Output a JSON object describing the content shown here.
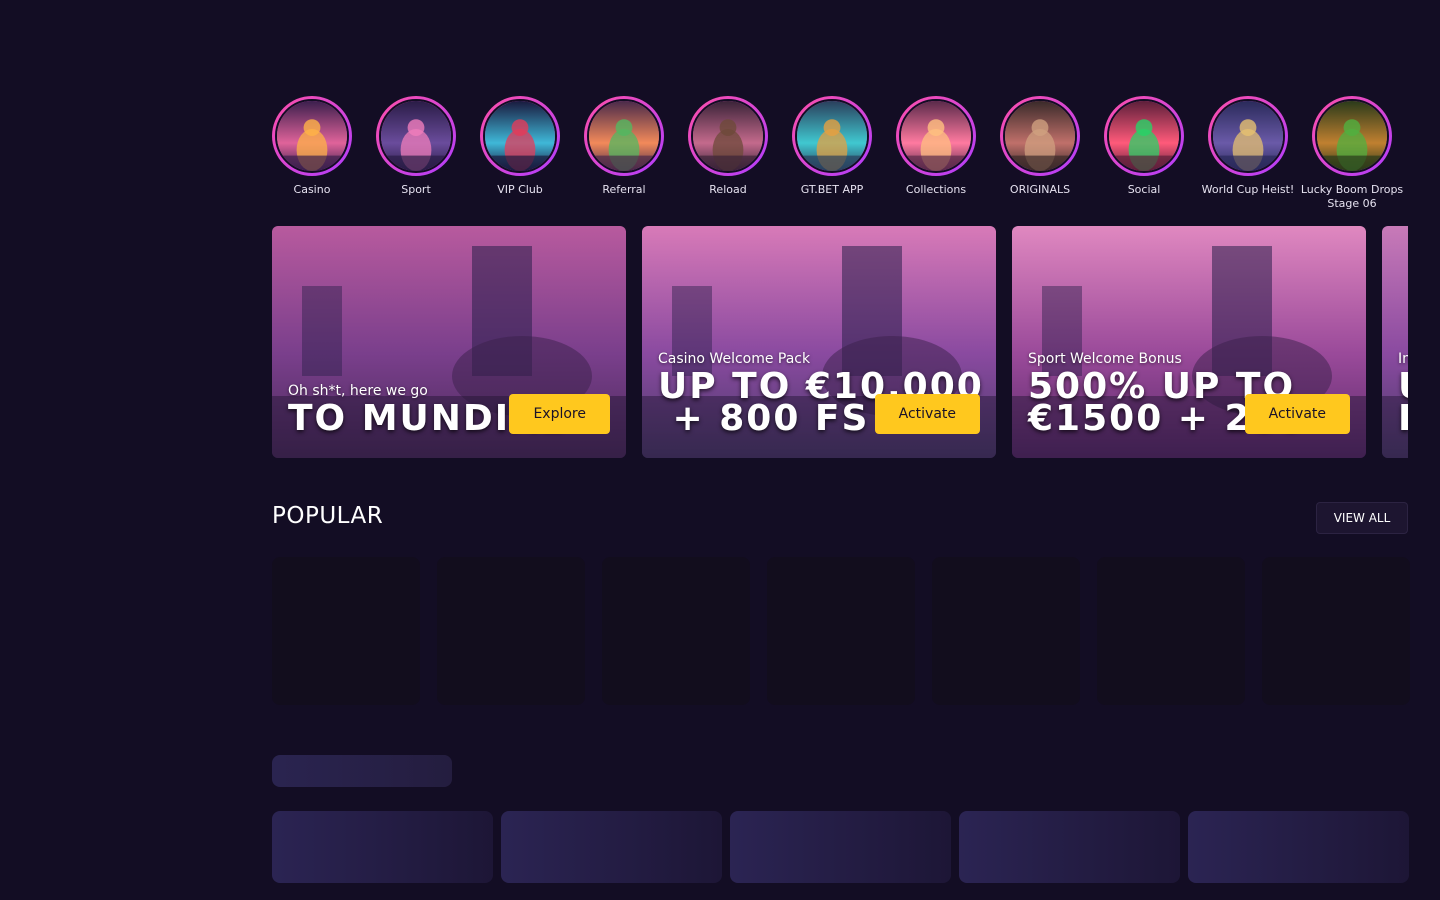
{
  "stories": [
    {
      "label": "Casino",
      "icon": "casino-story-icon",
      "colors": [
        "#3b1f4d",
        "#e0639a",
        "#ffb347"
      ]
    },
    {
      "label": "Sport",
      "icon": "sport-story-icon",
      "colors": [
        "#2a1c46",
        "#6a4c9c",
        "#f07dbb"
      ]
    },
    {
      "label": "VIP Club",
      "icon": "vip-club-story-icon",
      "colors": [
        "#1a1a3e",
        "#3fb8d8",
        "#e43b5a"
      ]
    },
    {
      "label": "Referral",
      "icon": "referral-story-icon",
      "colors": [
        "#4a2a4a",
        "#f28a5a",
        "#52b860"
      ]
    },
    {
      "label": "Reload",
      "icon": "reload-story-icon",
      "colors": [
        "#3a2338",
        "#c46a8c",
        "#6e4a3a"
      ]
    },
    {
      "label": "GT.BET APP",
      "icon": "gtbet-app-story-icon",
      "colors": [
        "#2a3f5c",
        "#40c8d0",
        "#e6a040"
      ]
    },
    {
      "label": "Collections",
      "icon": "collections-story-icon",
      "colors": [
        "#5a2a4a",
        "#ff7aa0",
        "#ffc080"
      ]
    },
    {
      "label": "ORIGINALS",
      "icon": "originals-story-icon",
      "colors": [
        "#3a2a2a",
        "#c0706a",
        "#d0a080"
      ]
    },
    {
      "label": "Social",
      "icon": "social-story-icon",
      "colors": [
        "#5c1f3a",
        "#ff5a7a",
        "#25d366"
      ]
    },
    {
      "label": "World Cup Heist!",
      "icon": "world-cup-story-icon",
      "colors": [
        "#2a2a5a",
        "#6a5aa8",
        "#e6c070"
      ]
    },
    {
      "label": "Lucky Boom Drops Stage 06",
      "icon": "lucky-boom-story-icon",
      "colors": [
        "#2a3a1a",
        "#c08030",
        "#50b040"
      ]
    }
  ],
  "promos": [
    {
      "subtitle": "Oh sh*t, here we go",
      "title": "TO MUNDIAL",
      "button": "Explore",
      "colors": [
        "#b85a9e",
        "#7a3f8c",
        "#4a2a5a"
      ]
    },
    {
      "subtitle": "Casino Welcome Pack",
      "title": "UP TO €10,000\n + 800 FS",
      "button": "Activate",
      "colors": [
        "#d87ab8",
        "#8a4aa0",
        "#4a3a6a"
      ]
    },
    {
      "subtitle": "Sport Welcome Bonus",
      "title": "500% UP TO\n€1500 + 200",
      "button": "Activate",
      "colors": [
        "#e088c0",
        "#9a4a9a",
        "#5a2a6a"
      ]
    },
    {
      "subtitle": "In",
      "title": "U\nF",
      "button": "",
      "colors": [
        "#c87ab8",
        "#8a4aa0",
        "#4a3a6a"
      ]
    }
  ],
  "popular": {
    "title": "POPULAR",
    "view_all": "VIEW ALL"
  }
}
